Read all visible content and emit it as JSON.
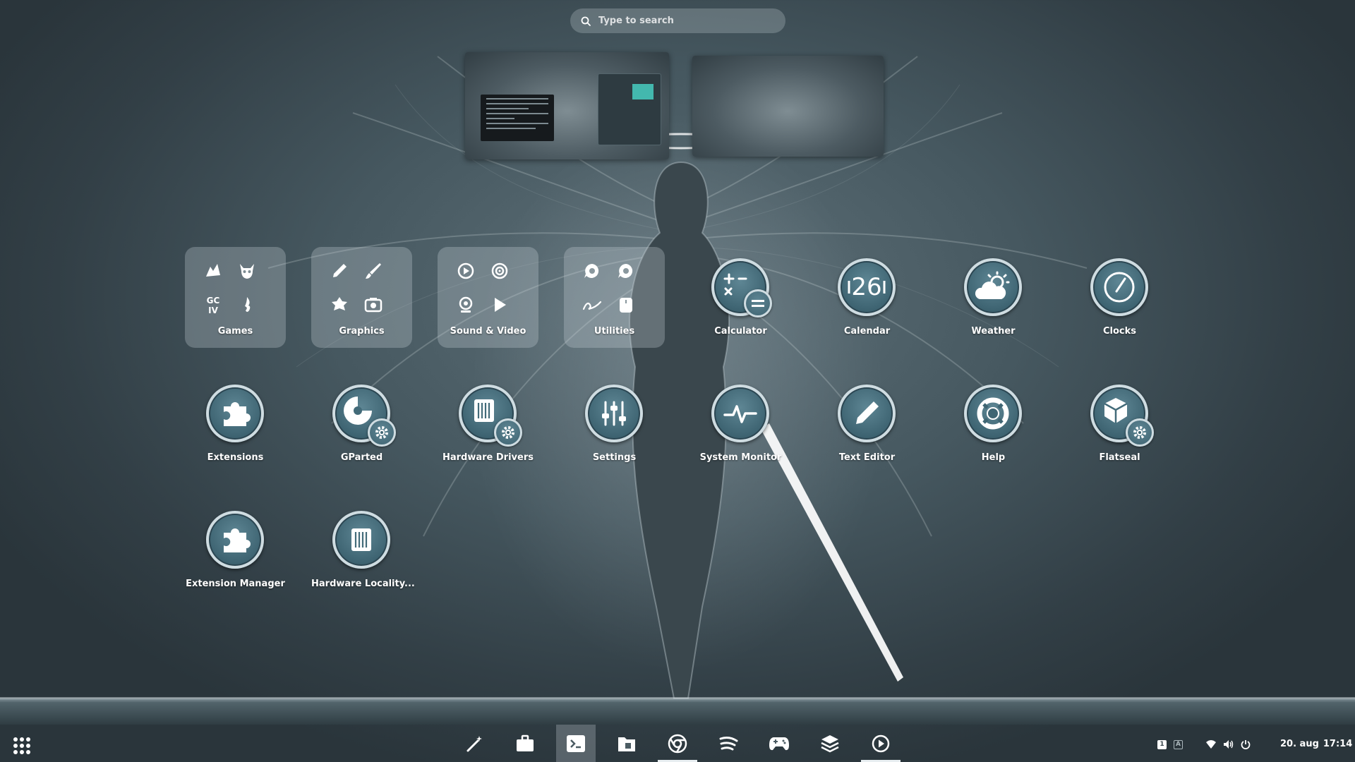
{
  "search": {
    "placeholder": "Type to search"
  },
  "folders": [
    {
      "label": "Games",
      "icons": [
        "dragon-icon",
        "demon-skull-icon",
        "gciv-icon",
        "flame-icon"
      ]
    },
    {
      "label": "Graphics",
      "icons": [
        "color-picker-icon",
        "brush-icon",
        "paint-splash-icon",
        "screenshot-icon"
      ]
    },
    {
      "label": "Sound & Video",
      "icons": [
        "play-circle-icon",
        "disc-icon",
        "webcam-icon",
        "play-icon"
      ]
    },
    {
      "label": "Utilities",
      "icons": [
        "chat-bubble-icon",
        "chat-bubble-alt-icon",
        "signature-icon",
        "mouse-icon"
      ]
    }
  ],
  "apps": [
    {
      "label": "Calculator",
      "icon": "calculator-icon"
    },
    {
      "label": "Calendar",
      "icon": "calendar-icon",
      "icon_text": "26"
    },
    {
      "label": "Weather",
      "icon": "weather-icon"
    },
    {
      "label": "Clocks",
      "icon": "clock-icon"
    },
    {
      "label": "Extensions",
      "icon": "puzzle-icon"
    },
    {
      "label": "GParted",
      "icon": "disk-gear-icon"
    },
    {
      "label": "Hardware Drivers",
      "icon": "chip-gear-icon"
    },
    {
      "label": "Settings",
      "icon": "sliders-icon"
    },
    {
      "label": "System Monitor",
      "icon": "pulse-icon"
    },
    {
      "label": "Text Editor",
      "icon": "pencil-icon"
    },
    {
      "label": "Help",
      "icon": "lifebuoy-icon"
    },
    {
      "label": "Flatseal",
      "icon": "box-gear-icon"
    },
    {
      "label": "Extension Manager",
      "icon": "puzzle-icon"
    },
    {
      "label": "Hardware Locality...",
      "icon": "chip-icon"
    }
  ],
  "dock": [
    {
      "name": "magic-wand",
      "icon": "magic-wand-icon"
    },
    {
      "name": "briefcase",
      "icon": "briefcase-icon"
    },
    {
      "name": "terminal",
      "icon": "terminal-icon",
      "active": true,
      "running": false
    },
    {
      "name": "files",
      "icon": "folder-icon"
    },
    {
      "name": "chrome",
      "icon": "chrome-icon",
      "running": true
    },
    {
      "name": "spotify",
      "icon": "spotify-icon"
    },
    {
      "name": "games",
      "icon": "gamepad-icon"
    },
    {
      "name": "stack",
      "icon": "layers-icon"
    },
    {
      "name": "media-player",
      "icon": "play-circle-icon",
      "running": true
    }
  ],
  "tray": {
    "workspace_active": "1",
    "keyboard_layout": "A"
  },
  "clock": {
    "date": "20. aug",
    "time": "17:14"
  }
}
